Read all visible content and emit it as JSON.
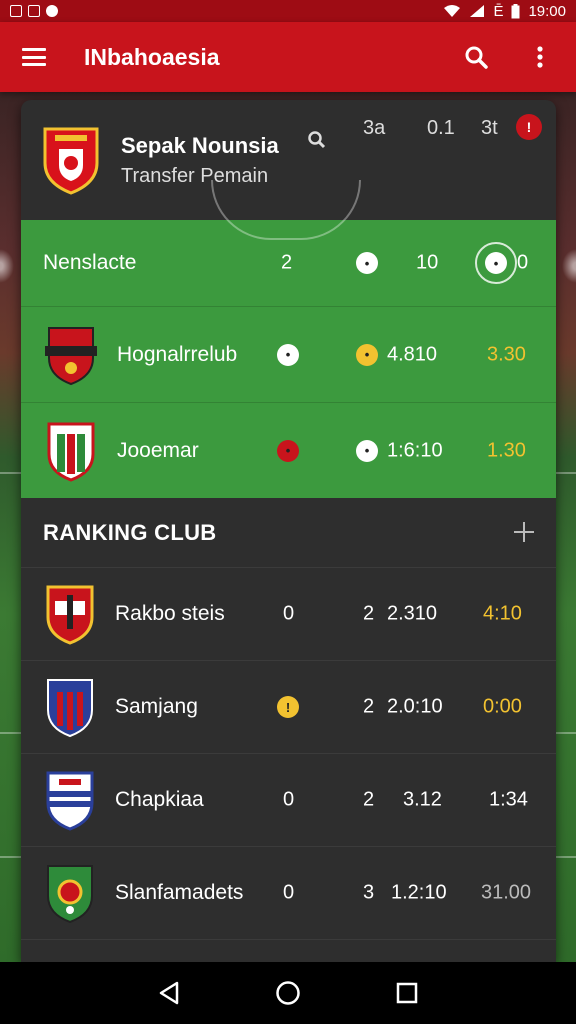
{
  "status_bar": {
    "left_text": "   ",
    "time": "19:00",
    "carrier": "Ē"
  },
  "app_bar": {
    "title": "INbahoaesia",
    "menu_icon": "menu-icon",
    "search_icon": "search-icon",
    "more_icon": "more-vert-icon"
  },
  "header": {
    "title": "Sepak Nounsia",
    "subtitle": "Transfer Pemain",
    "stats": [
      "3a",
      "0.1",
      "3t"
    ]
  },
  "green_rows": [
    {
      "name": "Nenslacte",
      "c1": "2",
      "c2": "10",
      "c3": "0"
    },
    {
      "name": "Hognalrrelub",
      "c2": "4.810",
      "c3": "3.30"
    },
    {
      "name": "Jooemar",
      "c2": "1:6:10",
      "c3": "1.30"
    }
  ],
  "ranking": {
    "title": "RANKING CLUB",
    "rows": [
      {
        "name": "Rakbo steis",
        "c1": "0",
        "c2": "2",
        "c3": "2.310",
        "c4": "4:10",
        "c4_yellow": true
      },
      {
        "name": "Samjang",
        "c1": "",
        "c2": "2",
        "c3": "2.0:10",
        "c4": "0:00",
        "c4_yellow": true
      },
      {
        "name": "Chapkiaa",
        "c1": "0",
        "c2": "2",
        "c3": "3.12",
        "c4": "1:34",
        "c4_yellow": false
      },
      {
        "name": "Slanfamadets",
        "c1": "0",
        "c2": "3",
        "c3": "1.2:10",
        "c4": "31.00",
        "c4_yellow": false
      }
    ]
  },
  "colors": {
    "brand_red": "#c8141c",
    "green": "#3c9a3e",
    "card": "#2e2e2e",
    "yellow": "#f2c230"
  }
}
